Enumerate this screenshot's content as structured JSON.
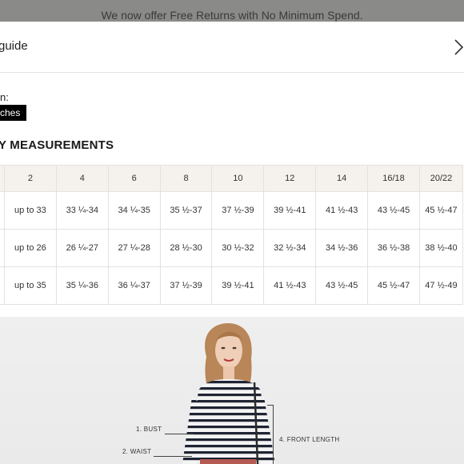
{
  "promo": {
    "text": "We now offer Free Returns with No Minimum Spend."
  },
  "modal": {
    "title": "guide",
    "close_icon": "chevron-right-icon",
    "view_label": "n:",
    "unit_toggle": "ches",
    "section_title": "Y MEASUREMENTS"
  },
  "table": {
    "headers": [
      "2",
      "4",
      "6",
      "8",
      "10",
      "12",
      "14",
      "16/18",
      "20/22"
    ],
    "rows": [
      [
        "up to 33",
        "33 ¼-34",
        "34 ¼-35",
        "35 ½-37",
        "37 ½-39",
        "39 ½-41",
        "41 ½-43",
        "43 ½-45",
        "45 ½-47"
      ],
      [
        "up to 26",
        "26 ¼-27",
        "27 ¼-28",
        "28 ½-30",
        "30 ½-32",
        "32 ½-34",
        "34 ½-36",
        "36 ½-38",
        "38 ½-40"
      ],
      [
        "up to 35",
        "35 ¼-36",
        "36 ¼-37",
        "37 ½-39",
        "39 ½-41",
        "41 ½-43",
        "43 ½-45",
        "45 ½-47",
        "47 ½-49"
      ]
    ]
  },
  "figure": {
    "labels": {
      "bust": "1. BUST",
      "waist": "2. WAIST",
      "front_length": "4. FRONT LENGTH"
    }
  },
  "colors": {
    "header_bg": "#f5f1ec",
    "toggle_bg": "#000000",
    "stripe": "#1f2433"
  }
}
